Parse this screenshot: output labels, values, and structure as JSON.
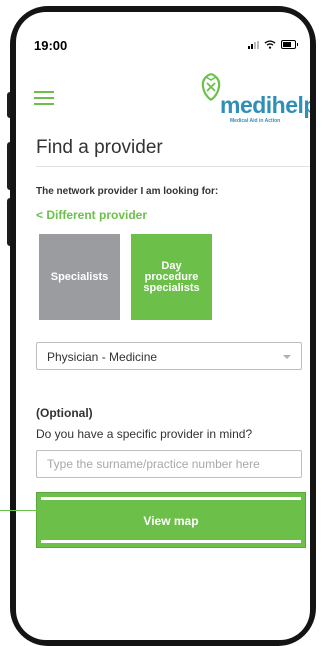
{
  "status_bar": {
    "time": "19:00",
    "icons": [
      "signal-icon",
      "wifi-icon",
      "battery-icon"
    ]
  },
  "header": {
    "menu_icon": "hamburger-menu-icon",
    "logo": {
      "name": "medihelp",
      "tagline": "Medical Aid in Action"
    }
  },
  "page": {
    "title": "Find a provider",
    "prompt": "The network provider I am looking for:",
    "back_link": "< Different provider"
  },
  "provider_types": [
    {
      "label": "Specialists"
    },
    {
      "label": "Day\nprocedure\nspecialists"
    }
  ],
  "provider_select": {
    "value": "Physician - Medicine"
  },
  "optional_section": {
    "label": "(Optional)",
    "question": "Do you have a specific provider in mind?",
    "input_value": "",
    "placeholder": "Type the surname/practice number here"
  },
  "view_map_button": {
    "label": "View map"
  },
  "colors": {
    "accent_green": "#6cc04a",
    "tile_grey": "#9a9ca0",
    "logo_blue": "#2f8fb8",
    "text_dark": "#333333"
  }
}
